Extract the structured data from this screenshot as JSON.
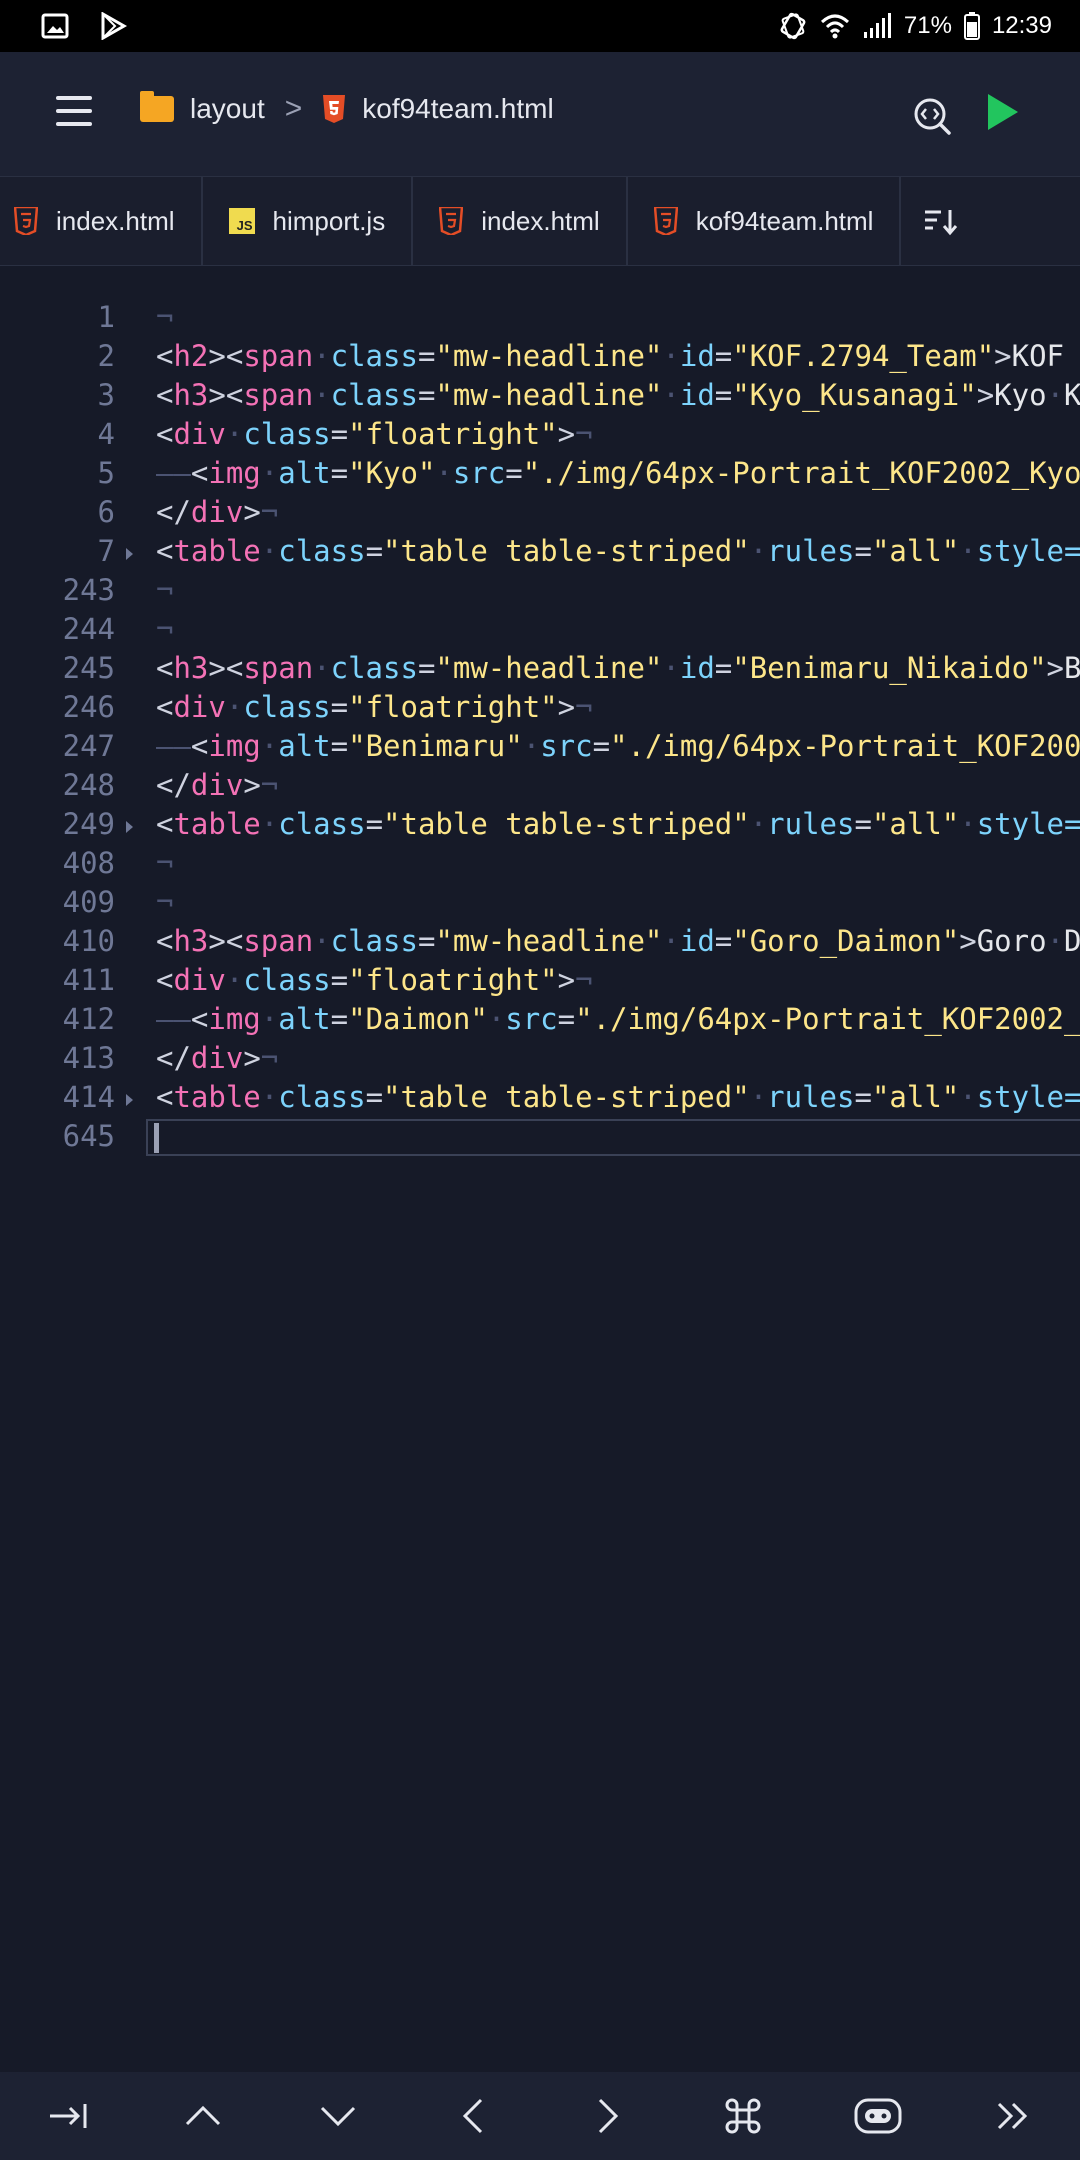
{
  "status_bar": {
    "battery": "71%",
    "time": "12:39",
    "icons": [
      "image-icon",
      "play-store-icon",
      "rotate-icon",
      "wifi-icon",
      "signal-icon",
      "battery-icon"
    ]
  },
  "app_bar": {
    "folder": "layout",
    "separator": ">",
    "file": "kof94team.html",
    "icons": [
      "menu-icon",
      "folder-icon",
      "html5-icon",
      "search-code-icon",
      "play-icon"
    ],
    "accent_play": "#22c55e"
  },
  "tabs": [
    {
      "label": "index.html",
      "icon": "html5-icon"
    },
    {
      "label": "himport.js",
      "icon": "js-icon"
    },
    {
      "label": "index.html",
      "icon": "html5-icon"
    },
    {
      "label": "kof94team.html",
      "icon": "html5-icon"
    }
  ],
  "editor": {
    "lines": [
      {
        "n": "1",
        "fold": false,
        "tokens": [
          [
            "ws",
            "¬"
          ]
        ]
      },
      {
        "n": "2",
        "fold": false,
        "tokens": [
          [
            "br",
            "<"
          ],
          [
            "tag",
            "h2"
          ],
          [
            "br",
            ">"
          ],
          [
            "br",
            "<"
          ],
          [
            "tag",
            "span"
          ],
          [
            "ws",
            "·"
          ],
          [
            "attr",
            "class"
          ],
          [
            "br",
            "="
          ],
          [
            "val",
            "\"mw-headline\""
          ],
          [
            "ws",
            "·"
          ],
          [
            "attr",
            "id"
          ],
          [
            "br",
            "="
          ],
          [
            "val",
            "\"KOF.2794_Team\""
          ],
          [
            "br",
            ">"
          ],
          [
            "txt",
            "KOF"
          ]
        ]
      },
      {
        "n": "3",
        "fold": false,
        "tokens": [
          [
            "br",
            "<"
          ],
          [
            "tag",
            "h3"
          ],
          [
            "br",
            ">"
          ],
          [
            "br",
            "<"
          ],
          [
            "tag",
            "span"
          ],
          [
            "ws",
            "·"
          ],
          [
            "attr",
            "class"
          ],
          [
            "br",
            "="
          ],
          [
            "val",
            "\"mw-headline\""
          ],
          [
            "ws",
            "·"
          ],
          [
            "attr",
            "id"
          ],
          [
            "br",
            "="
          ],
          [
            "val",
            "\"Kyo_Kusanagi\""
          ],
          [
            "br",
            ">"
          ],
          [
            "txt",
            "Kyo"
          ],
          [
            "ws",
            "·"
          ],
          [
            "txt",
            "K"
          ]
        ]
      },
      {
        "n": "4",
        "fold": false,
        "tokens": [
          [
            "br",
            "<"
          ],
          [
            "tag",
            "div"
          ],
          [
            "ws",
            "·"
          ],
          [
            "attr",
            "class"
          ],
          [
            "br",
            "="
          ],
          [
            "val",
            "\"floatright\""
          ],
          [
            "br",
            ">"
          ],
          [
            "ws",
            "¬"
          ]
        ]
      },
      {
        "n": "5",
        "fold": false,
        "tokens": [
          [
            "ws",
            "——"
          ],
          [
            "br",
            "<"
          ],
          [
            "tag",
            "img"
          ],
          [
            "ws",
            "·"
          ],
          [
            "attr",
            "alt"
          ],
          [
            "br",
            "="
          ],
          [
            "val",
            "\"Kyo\""
          ],
          [
            "ws",
            "·"
          ],
          [
            "attr",
            "src"
          ],
          [
            "br",
            "="
          ],
          [
            "val",
            "\"./img/64px-Portrait_KOF2002_Kyo"
          ]
        ]
      },
      {
        "n": "6",
        "fold": false,
        "tokens": [
          [
            "br",
            "</"
          ],
          [
            "tag",
            "div"
          ],
          [
            "br",
            ">"
          ],
          [
            "ws",
            "¬"
          ]
        ]
      },
      {
        "n": "7",
        "fold": true,
        "tokens": [
          [
            "br",
            "<"
          ],
          [
            "tag",
            "table"
          ],
          [
            "ws",
            "·"
          ],
          [
            "attr",
            "class"
          ],
          [
            "br",
            "="
          ],
          [
            "val",
            "\"table table-striped\""
          ],
          [
            "ws",
            "·"
          ],
          [
            "attr",
            "rules"
          ],
          [
            "br",
            "="
          ],
          [
            "val",
            "\"all\""
          ],
          [
            "ws",
            "·"
          ],
          [
            "attr",
            "style="
          ]
        ]
      },
      {
        "n": "243",
        "fold": false,
        "tokens": [
          [
            "ws",
            "¬"
          ]
        ]
      },
      {
        "n": "244",
        "fold": false,
        "tokens": [
          [
            "ws",
            "¬"
          ]
        ]
      },
      {
        "n": "245",
        "fold": false,
        "tokens": [
          [
            "br",
            "<"
          ],
          [
            "tag",
            "h3"
          ],
          [
            "br",
            ">"
          ],
          [
            "br",
            "<"
          ],
          [
            "tag",
            "span"
          ],
          [
            "ws",
            "·"
          ],
          [
            "attr",
            "class"
          ],
          [
            "br",
            "="
          ],
          [
            "val",
            "\"mw-headline\""
          ],
          [
            "ws",
            "·"
          ],
          [
            "attr",
            "id"
          ],
          [
            "br",
            "="
          ],
          [
            "val",
            "\"Benimaru_Nikaido\""
          ],
          [
            "br",
            ">"
          ],
          [
            "txt",
            "B"
          ]
        ]
      },
      {
        "n": "246",
        "fold": false,
        "tokens": [
          [
            "br",
            "<"
          ],
          [
            "tag",
            "div"
          ],
          [
            "ws",
            "·"
          ],
          [
            "attr",
            "class"
          ],
          [
            "br",
            "="
          ],
          [
            "val",
            "\"floatright\""
          ],
          [
            "br",
            ">"
          ],
          [
            "ws",
            "¬"
          ]
        ]
      },
      {
        "n": "247",
        "fold": false,
        "tokens": [
          [
            "ws",
            "——"
          ],
          [
            "br",
            "<"
          ],
          [
            "tag",
            "img"
          ],
          [
            "ws",
            "·"
          ],
          [
            "attr",
            "alt"
          ],
          [
            "br",
            "="
          ],
          [
            "val",
            "\"Benimaru\""
          ],
          [
            "ws",
            "·"
          ],
          [
            "attr",
            "src"
          ],
          [
            "br",
            "="
          ],
          [
            "val",
            "\"./img/64px-Portrait_KOF200"
          ]
        ]
      },
      {
        "n": "248",
        "fold": false,
        "tokens": [
          [
            "br",
            "</"
          ],
          [
            "tag",
            "div"
          ],
          [
            "br",
            ">"
          ],
          [
            "ws",
            "¬"
          ]
        ]
      },
      {
        "n": "249",
        "fold": true,
        "tokens": [
          [
            "br",
            "<"
          ],
          [
            "tag",
            "table"
          ],
          [
            "ws",
            "·"
          ],
          [
            "attr",
            "class"
          ],
          [
            "br",
            "="
          ],
          [
            "val",
            "\"table table-striped\""
          ],
          [
            "ws",
            "·"
          ],
          [
            "attr",
            "rules"
          ],
          [
            "br",
            "="
          ],
          [
            "val",
            "\"all\""
          ],
          [
            "ws",
            "·"
          ],
          [
            "attr",
            "style="
          ]
        ]
      },
      {
        "n": "408",
        "fold": false,
        "tokens": [
          [
            "ws",
            "¬"
          ]
        ]
      },
      {
        "n": "409",
        "fold": false,
        "tokens": [
          [
            "ws",
            "¬"
          ]
        ]
      },
      {
        "n": "410",
        "fold": false,
        "tokens": [
          [
            "br",
            "<"
          ],
          [
            "tag",
            "h3"
          ],
          [
            "br",
            ">"
          ],
          [
            "br",
            "<"
          ],
          [
            "tag",
            "span"
          ],
          [
            "ws",
            "·"
          ],
          [
            "attr",
            "class"
          ],
          [
            "br",
            "="
          ],
          [
            "val",
            "\"mw-headline\""
          ],
          [
            "ws",
            "·"
          ],
          [
            "attr",
            "id"
          ],
          [
            "br",
            "="
          ],
          [
            "val",
            "\"Goro_Daimon\""
          ],
          [
            "br",
            ">"
          ],
          [
            "txt",
            "Goro"
          ],
          [
            "ws",
            "·"
          ],
          [
            "txt",
            "D"
          ]
        ]
      },
      {
        "n": "411",
        "fold": false,
        "tokens": [
          [
            "br",
            "<"
          ],
          [
            "tag",
            "div"
          ],
          [
            "ws",
            "·"
          ],
          [
            "attr",
            "class"
          ],
          [
            "br",
            "="
          ],
          [
            "val",
            "\"floatright\""
          ],
          [
            "br",
            ">"
          ],
          [
            "ws",
            "¬"
          ]
        ]
      },
      {
        "n": "412",
        "fold": false,
        "tokens": [
          [
            "ws",
            "——"
          ],
          [
            "br",
            "<"
          ],
          [
            "tag",
            "img"
          ],
          [
            "ws",
            "·"
          ],
          [
            "attr",
            "alt"
          ],
          [
            "br",
            "="
          ],
          [
            "val",
            "\"Daimon\""
          ],
          [
            "ws",
            "·"
          ],
          [
            "attr",
            "src"
          ],
          [
            "br",
            "="
          ],
          [
            "val",
            "\"./img/64px-Portrait_KOF2002_"
          ]
        ]
      },
      {
        "n": "413",
        "fold": false,
        "tokens": [
          [
            "br",
            "</"
          ],
          [
            "tag",
            "div"
          ],
          [
            "br",
            ">"
          ],
          [
            "ws",
            "¬"
          ]
        ]
      },
      {
        "n": "414",
        "fold": true,
        "tokens": [
          [
            "br",
            "<"
          ],
          [
            "tag",
            "table"
          ],
          [
            "ws",
            "·"
          ],
          [
            "attr",
            "class"
          ],
          [
            "br",
            "="
          ],
          [
            "val",
            "\"table table-striped\""
          ],
          [
            "ws",
            "·"
          ],
          [
            "attr",
            "rules"
          ],
          [
            "br",
            "="
          ],
          [
            "val",
            "\"all\""
          ],
          [
            "ws",
            "·"
          ],
          [
            "attr",
            "style="
          ]
        ]
      },
      {
        "n": "645",
        "fold": false,
        "current": true,
        "tokens": []
      }
    ],
    "colors": {
      "background": "#161a28",
      "tag": "#f472b6",
      "attr": "#7dd3fc",
      "value": "#fde68a",
      "line_number": "#6f7896"
    }
  },
  "bottom_toolbar": {
    "buttons": [
      "tab-key-icon",
      "arrow-up-icon",
      "arrow-down-icon",
      "arrow-left-icon",
      "arrow-right-icon",
      "command-icon",
      "assistant-icon",
      "more-icon"
    ]
  }
}
